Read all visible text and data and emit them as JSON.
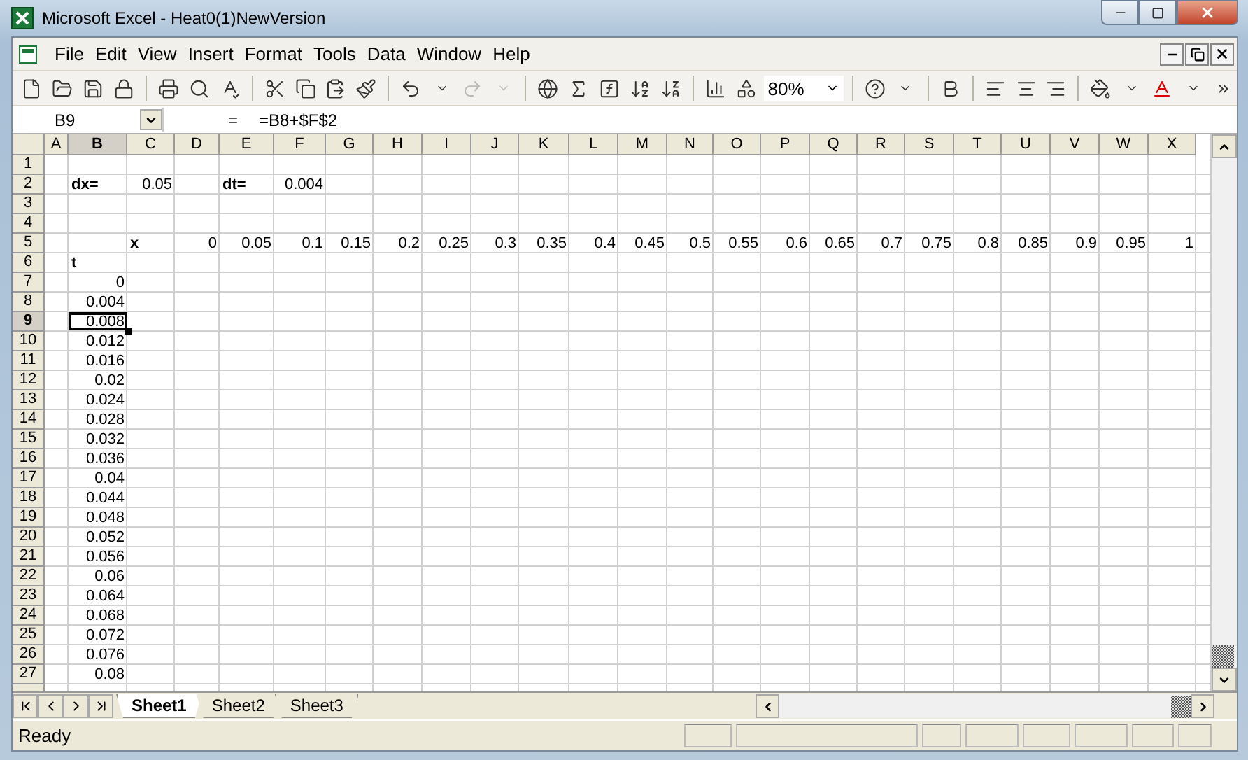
{
  "window": {
    "title": "Microsoft Excel - Heat0(1)NewVersion"
  },
  "menu": [
    "File",
    "Edit",
    "View",
    "Insert",
    "Format",
    "Tools",
    "Data",
    "Window",
    "Help"
  ],
  "toolbar": {
    "zoom": "80%"
  },
  "formula_bar": {
    "name_box": "B9",
    "equals": "=",
    "formula": "=B8+$F$2"
  },
  "columns": [
    {
      "label": "A",
      "selected": false
    },
    {
      "label": "B",
      "selected": true
    },
    {
      "label": "C",
      "selected": false
    },
    {
      "label": "D",
      "selected": false
    },
    {
      "label": "E",
      "selected": false
    },
    {
      "label": "F",
      "selected": false
    },
    {
      "label": "G",
      "selected": false
    },
    {
      "label": "H",
      "selected": false
    },
    {
      "label": "I",
      "selected": false
    },
    {
      "label": "J",
      "selected": false
    },
    {
      "label": "K",
      "selected": false
    },
    {
      "label": "L",
      "selected": false
    },
    {
      "label": "M",
      "selected": false
    },
    {
      "label": "N",
      "selected": false
    },
    {
      "label": "O",
      "selected": false
    },
    {
      "label": "P",
      "selected": false
    },
    {
      "label": "Q",
      "selected": false
    },
    {
      "label": "R",
      "selected": false
    },
    {
      "label": "S",
      "selected": false
    },
    {
      "label": "T",
      "selected": false
    },
    {
      "label": "U",
      "selected": false
    },
    {
      "label": "V",
      "selected": false
    },
    {
      "label": "W",
      "selected": false
    },
    {
      "label": "X",
      "selected": false
    }
  ],
  "rows": [
    {
      "label": "1",
      "selected": false,
      "cells": []
    },
    {
      "label": "2",
      "selected": false,
      "cells": [
        null,
        {
          "text": "dx=",
          "kind": "label",
          "selected": false
        },
        {
          "text": "0.05",
          "kind": "number",
          "selected": false
        },
        null,
        {
          "text": "dt=",
          "kind": "label",
          "selected": false
        },
        {
          "text": "0.004",
          "kind": "number",
          "selected": false
        }
      ]
    },
    {
      "label": "3",
      "selected": false,
      "cells": []
    },
    {
      "label": "4",
      "selected": false,
      "cells": []
    },
    {
      "label": "5",
      "selected": false,
      "cells": [
        null,
        null,
        {
          "text": "x",
          "kind": "label",
          "selected": false
        },
        {
          "text": "0",
          "kind": "number",
          "selected": false
        },
        {
          "text": "0.05",
          "kind": "number",
          "selected": false
        },
        {
          "text": "0.1",
          "kind": "number",
          "selected": false
        },
        {
          "text": "0.15",
          "kind": "number",
          "selected": false
        },
        {
          "text": "0.2",
          "kind": "number",
          "selected": false
        },
        {
          "text": "0.25",
          "kind": "number",
          "selected": false
        },
        {
          "text": "0.3",
          "kind": "number",
          "selected": false
        },
        {
          "text": "0.35",
          "kind": "number",
          "selected": false
        },
        {
          "text": "0.4",
          "kind": "number",
          "selected": false
        },
        {
          "text": "0.45",
          "kind": "number",
          "selected": false
        },
        {
          "text": "0.5",
          "kind": "number",
          "selected": false
        },
        {
          "text": "0.55",
          "kind": "number",
          "selected": false
        },
        {
          "text": "0.6",
          "kind": "number",
          "selected": false
        },
        {
          "text": "0.65",
          "kind": "number",
          "selected": false
        },
        {
          "text": "0.7",
          "kind": "number",
          "selected": false
        },
        {
          "text": "0.75",
          "kind": "number",
          "selected": false
        },
        {
          "text": "0.8",
          "kind": "number",
          "selected": false
        },
        {
          "text": "0.85",
          "kind": "number",
          "selected": false
        },
        {
          "text": "0.9",
          "kind": "number",
          "selected": false
        },
        {
          "text": "0.95",
          "kind": "number",
          "selected": false
        },
        {
          "text": "1",
          "kind": "number",
          "selected": false
        }
      ]
    },
    {
      "label": "6",
      "selected": false,
      "cells": [
        null,
        {
          "text": "t",
          "kind": "label",
          "selected": false
        }
      ]
    },
    {
      "label": "7",
      "selected": false,
      "cells": [
        null,
        {
          "text": "0",
          "kind": "number",
          "selected": false
        }
      ]
    },
    {
      "label": "8",
      "selected": false,
      "cells": [
        null,
        {
          "text": "0.004",
          "kind": "number",
          "selected": false
        }
      ]
    },
    {
      "label": "9",
      "selected": true,
      "cells": [
        null,
        {
          "text": "0.008",
          "kind": "number",
          "selected": true
        }
      ]
    },
    {
      "label": "10",
      "selected": false,
      "cells": [
        null,
        {
          "text": "0.012",
          "kind": "number",
          "selected": false
        }
      ]
    },
    {
      "label": "11",
      "selected": false,
      "cells": [
        null,
        {
          "text": "0.016",
          "kind": "number",
          "selected": false
        }
      ]
    },
    {
      "label": "12",
      "selected": false,
      "cells": [
        null,
        {
          "text": "0.02",
          "kind": "number",
          "selected": false
        }
      ]
    },
    {
      "label": "13",
      "selected": false,
      "cells": [
        null,
        {
          "text": "0.024",
          "kind": "number",
          "selected": false
        }
      ]
    },
    {
      "label": "14",
      "selected": false,
      "cells": [
        null,
        {
          "text": "0.028",
          "kind": "number",
          "selected": false
        }
      ]
    },
    {
      "label": "15",
      "selected": false,
      "cells": [
        null,
        {
          "text": "0.032",
          "kind": "number",
          "selected": false
        }
      ]
    },
    {
      "label": "16",
      "selected": false,
      "cells": [
        null,
        {
          "text": "0.036",
          "kind": "number",
          "selected": false
        }
      ]
    },
    {
      "label": "17",
      "selected": false,
      "cells": [
        null,
        {
          "text": "0.04",
          "kind": "number",
          "selected": false
        }
      ]
    },
    {
      "label": "18",
      "selected": false,
      "cells": [
        null,
        {
          "text": "0.044",
          "kind": "number",
          "selected": false
        }
      ]
    },
    {
      "label": "19",
      "selected": false,
      "cells": [
        null,
        {
          "text": "0.048",
          "kind": "number",
          "selected": false
        }
      ]
    },
    {
      "label": "20",
      "selected": false,
      "cells": [
        null,
        {
          "text": "0.052",
          "kind": "number",
          "selected": false
        }
      ]
    },
    {
      "label": "21",
      "selected": false,
      "cells": [
        null,
        {
          "text": "0.056",
          "kind": "number",
          "selected": false
        }
      ]
    },
    {
      "label": "22",
      "selected": false,
      "cells": [
        null,
        {
          "text": "0.06",
          "kind": "number",
          "selected": false
        }
      ]
    },
    {
      "label": "23",
      "selected": false,
      "cells": [
        null,
        {
          "text": "0.064",
          "kind": "number",
          "selected": false
        }
      ]
    },
    {
      "label": "24",
      "selected": false,
      "cells": [
        null,
        {
          "text": "0.068",
          "kind": "number",
          "selected": false
        }
      ]
    },
    {
      "label": "25",
      "selected": false,
      "cells": [
        null,
        {
          "text": "0.072",
          "kind": "number",
          "selected": false
        }
      ]
    },
    {
      "label": "26",
      "selected": false,
      "cells": [
        null,
        {
          "text": "0.076",
          "kind": "number",
          "selected": false
        }
      ]
    },
    {
      "label": "27",
      "selected": false,
      "cells": [
        null,
        {
          "text": "0.08",
          "kind": "number",
          "selected": false
        }
      ]
    }
  ],
  "sheet_tabs": [
    {
      "label": "Sheet1",
      "selected": true
    },
    {
      "label": "Sheet2",
      "selected": false
    },
    {
      "label": "Sheet3",
      "selected": false
    }
  ],
  "status_bar": {
    "text": "Ready"
  }
}
